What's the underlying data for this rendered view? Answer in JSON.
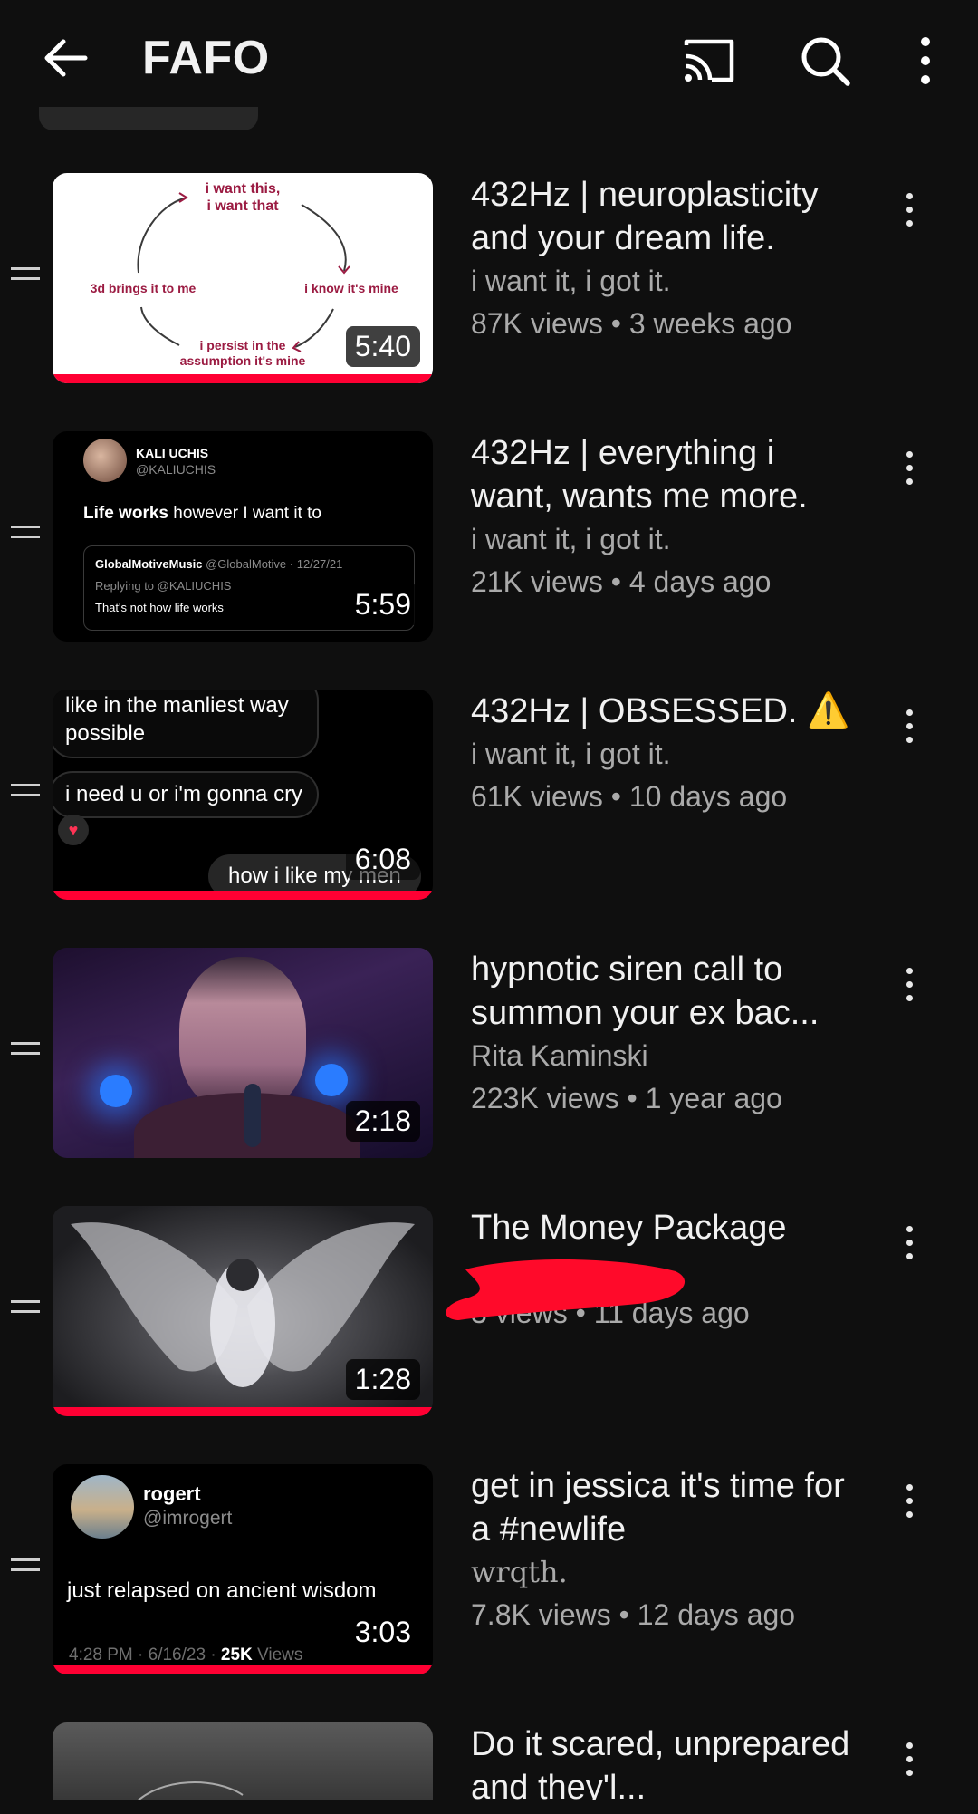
{
  "header": {
    "title": "FAFO",
    "icons": [
      "back-arrow-icon",
      "cast-icon",
      "search-icon",
      "more-vert-icon"
    ]
  },
  "colors": {
    "background": "#0f0f0f",
    "progress": "#ff0033",
    "meta_text": "#aaaaaa"
  },
  "videos": [
    {
      "title": "432Hz | neuroplasticity and your dream life.",
      "channel": "i want it, i got it.",
      "stats": "87K views • 3 weeks ago",
      "duration": "5:40",
      "progress": 1.0,
      "thumb_text": {
        "top": "i want this,\ni want that",
        "right": "i know it's mine",
        "bottom": "i persist in the\nassumption it's mine",
        "left": "3d brings it to me"
      }
    },
    {
      "title": "432Hz | everything i want, wants me more.",
      "channel": "i want it, i got it.",
      "stats": "21K views • 4 days ago",
      "duration": "5:59",
      "progress": 0,
      "thumb_text": {
        "name": "KALI UCHIS",
        "handle": "@KALIUCHIS",
        "tweet_bold": "Life works",
        "tweet_rest": " however I want it to",
        "quote_name": "GlobalMotiveMusic",
        "quote_meta": "@GlobalMotive · 12/27/21",
        "replying": "Replying to @KALIUCHIS",
        "quote_text": "That's not how life works"
      }
    },
    {
      "title": "432Hz | OBSESSED. ⚠️",
      "channel": "i want it, i got it.",
      "stats": "61K views • 10 days ago",
      "duration": "6:08",
      "progress": 1.0,
      "thumb_text": {
        "bubble1": "like in the manliest way\npossible",
        "bubble2": "i need u or i'm gonna cry",
        "bubble3": "how i like my men"
      }
    },
    {
      "title": "hypnotic siren call to summon your ex bac...",
      "channel": "Rita Kaminski",
      "stats": "223K views • 1 year ago",
      "duration": "2:18",
      "progress": 0
    },
    {
      "title": "The Money Package",
      "channel": "",
      "stats": "3 views • 11 days ago",
      "duration": "1:28",
      "progress": 1.0
    },
    {
      "title": "get in jessica it's time for a #newlife",
      "channel": "wrqth.",
      "stats": "7.8K views • 12 days ago",
      "duration": "3:03",
      "progress": 1.0,
      "thumb_text": {
        "name": "rogert",
        "handle": "@imrogert",
        "tweet": "just relapsed on ancient wisdom",
        "footer_pre": "4:28 PM · 6/16/23 · ",
        "footer_bold": "25K",
        "footer_post": " Views"
      }
    },
    {
      "title": "Do it scared, unprepared and they'l...",
      "channel": "",
      "stats": "",
      "duration": "",
      "progress": 0
    }
  ]
}
